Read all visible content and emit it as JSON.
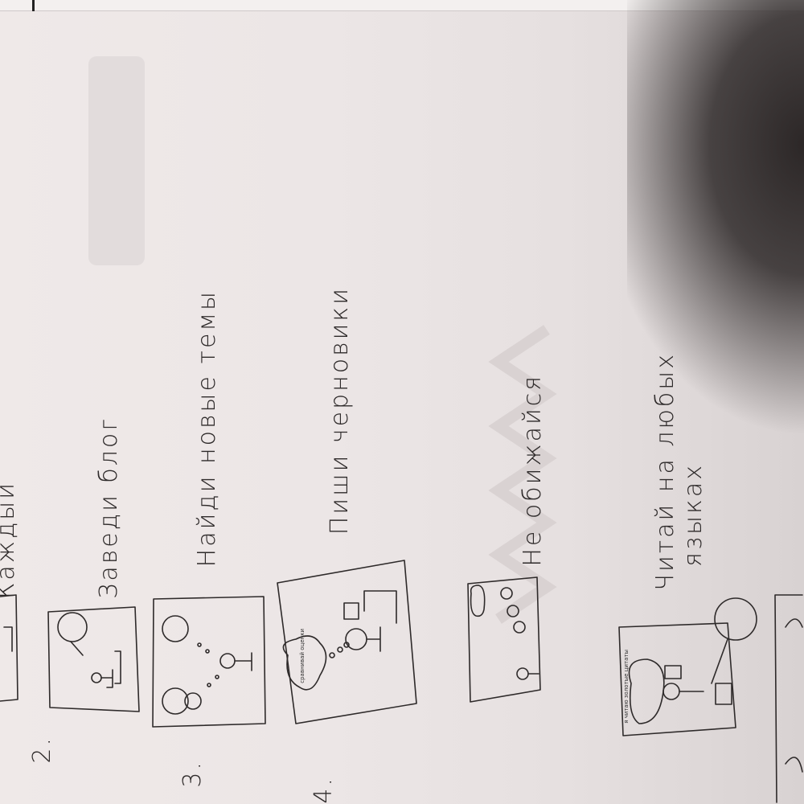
{
  "page": {
    "top_cutoff_text": "Каждый",
    "items": [
      {
        "number": "2.",
        "caption": "Заведи блог",
        "bubble": ""
      },
      {
        "number": "3.",
        "caption": "Найди новые темы",
        "bubble": ""
      },
      {
        "number": "4.",
        "caption": "Пиши черновики",
        "bubble": "сравнивай оценки"
      },
      {
        "number": "",
        "caption": "Не обижайся",
        "bubble": ""
      },
      {
        "number": "",
        "caption": "Читай на любых",
        "caption2": "языках",
        "bubble": "я читаю золотые цитаты"
      }
    ]
  }
}
